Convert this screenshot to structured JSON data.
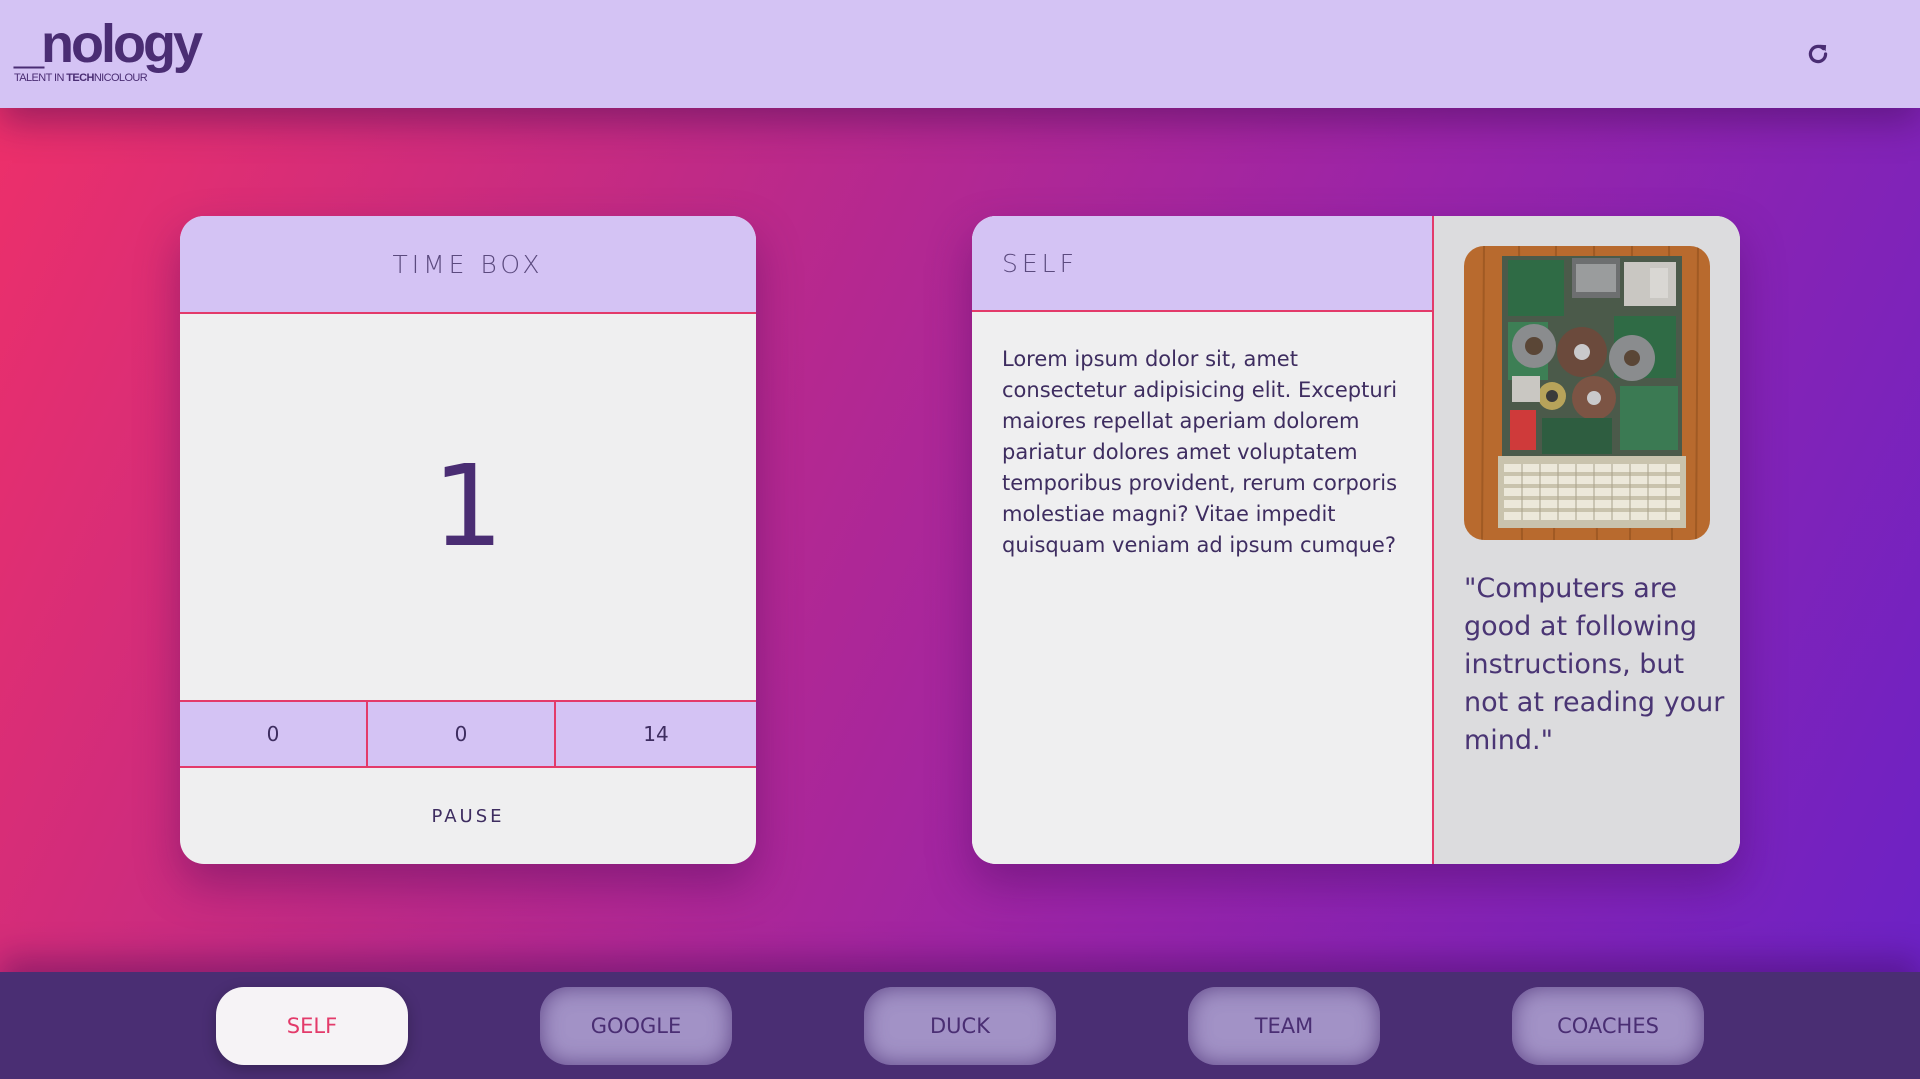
{
  "header": {
    "logo_text": "_nology",
    "tagline_prefix": "TALENT IN ",
    "tagline_bold": "TECH",
    "tagline_suffix": "NICOLOUR",
    "refresh_icon": "refresh-icon"
  },
  "timebox": {
    "title": "TIME BOX",
    "display_value": "1",
    "fields": [
      "0",
      "0",
      "14"
    ],
    "pause_label": "PAUSE"
  },
  "self_card": {
    "title": "SELF",
    "body": "Lorem ipsum dolor sit, amet consectetur adipisicing elit. Excepturi maiores repellat aperiam dolorem pariatur dolores amet voluptatem temporibus provident, rerum corporis molestiae magni? Vitae impedit quisquam veniam ad ipsum cumque?",
    "quote": "\"Computers are good at following instructions, but not at reading your mind.\""
  },
  "nav": {
    "items": [
      "SELF",
      "GOOGLE",
      "DUCK",
      "TEAM",
      "COACHES"
    ],
    "active": "SELF"
  },
  "colors": {
    "brand_purple": "#4a2d73",
    "lavender": "#d4c3f4",
    "accent_pink": "#e33a6a"
  }
}
